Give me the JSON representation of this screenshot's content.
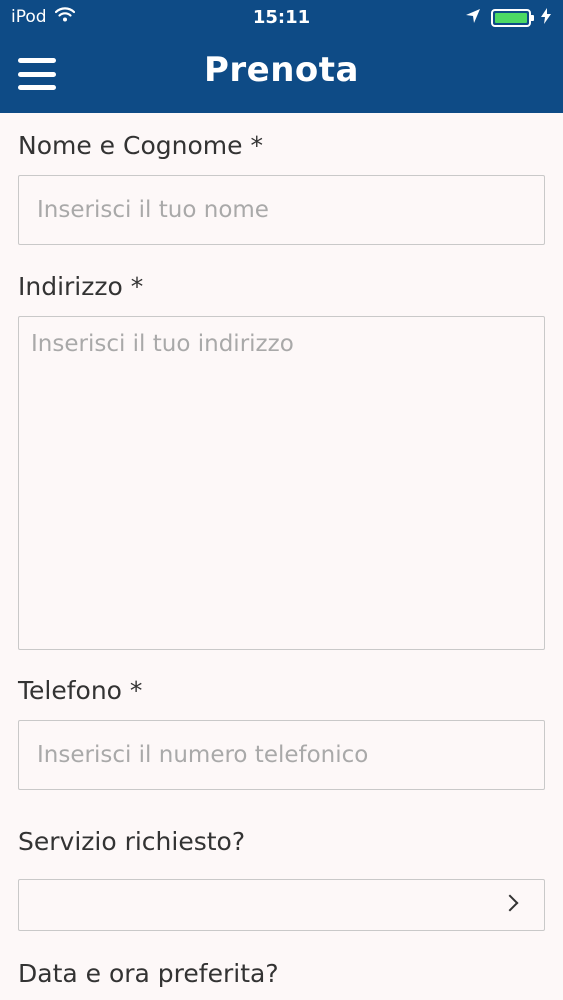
{
  "status_bar": {
    "carrier": "iPod",
    "time": "15:11",
    "battery_color": "#4cd964"
  },
  "nav": {
    "title": "Prenota",
    "menu_icon": "hamburger-menu-icon",
    "bar_color": "#0e4b86"
  },
  "form": {
    "name": {
      "label": "Nome e Cognome *",
      "placeholder": "Inserisci il tuo nome",
      "value": ""
    },
    "address": {
      "label": "Indirizzo *",
      "placeholder": "Inserisci il tuo indirizzo",
      "value": ""
    },
    "phone": {
      "label": "Telefono *",
      "placeholder": "Inserisci il numero telefonico",
      "value": ""
    },
    "service": {
      "label": "Servizio richiesto?",
      "value": "",
      "icon": "chevron-right-icon"
    },
    "datetime": {
      "label": "Data e ora preferita?"
    }
  }
}
